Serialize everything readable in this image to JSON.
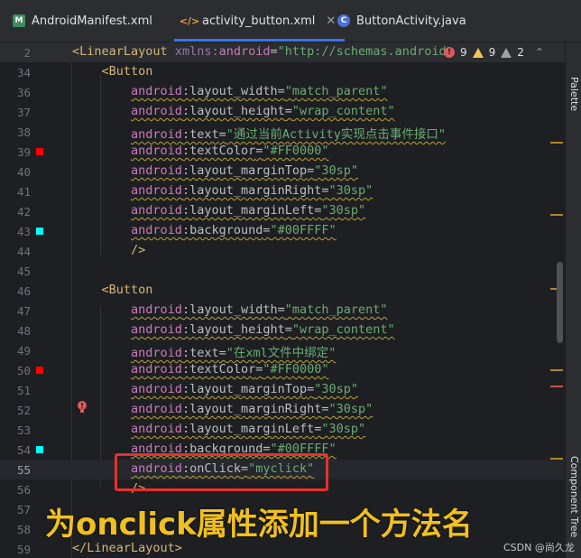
{
  "tabs": [
    {
      "icon": "manifest-icon",
      "label": "AndroidManifest.xml",
      "active": false
    },
    {
      "icon": "xml-code-icon",
      "label": "activity_button.xml",
      "active": true
    },
    {
      "icon": "java-class-icon",
      "label": "ButtonActivity.java",
      "active": false
    }
  ],
  "sticky": {
    "line": "2",
    "tag": "<LinearLayout",
    "attr_ns": "xmlns:",
    "attr": "android",
    "eq": "=",
    "value": "\"http://schemas.android"
  },
  "inspections": {
    "errors": "9",
    "warnings": "9",
    "weak": "2"
  },
  "right_panel": {
    "palette": "Palette",
    "component_tree": "Component Tree"
  },
  "lines": [
    {
      "n": "34",
      "indent": "    ",
      "tag": "<Button"
    },
    {
      "n": "36",
      "indent": "        ",
      "ns": "android",
      "attr": ":layout_width",
      "val": "\"match_parent\""
    },
    {
      "n": "37",
      "indent": "        ",
      "ns": "android",
      "attr": ":layout_height",
      "val": "\"wrap_content\""
    },
    {
      "n": "38",
      "indent": "        ",
      "ns": "android",
      "attr": ":text",
      "val": "\"通过当前Activity实现点击事件接口\""
    },
    {
      "n": "39",
      "indent": "        ",
      "ns": "android",
      "attr": ":textColor",
      "val": "\"#FF0000\""
    },
    {
      "n": "40",
      "indent": "        ",
      "ns": "android",
      "attr": ":layout_marginTop",
      "val": "\"30sp\""
    },
    {
      "n": "41",
      "indent": "        ",
      "ns": "android",
      "attr": ":layout_marginRight",
      "val": "\"30sp\""
    },
    {
      "n": "42",
      "indent": "        ",
      "ns": "android",
      "attr": ":layout_marginLeft",
      "val": "\"30sp\""
    },
    {
      "n": "43",
      "indent": "        ",
      "ns": "android",
      "attr": ":background",
      "val": "\"#00FFFF\""
    },
    {
      "n": "44",
      "indent": "        ",
      "tag": "/>"
    },
    {
      "n": "45",
      "indent": "",
      "tag": ""
    },
    {
      "n": "46",
      "indent": "    ",
      "tag": "<Button"
    },
    {
      "n": "47",
      "indent": "        ",
      "ns": "android",
      "attr": ":layout_width",
      "val": "\"match_parent\""
    },
    {
      "n": "48",
      "indent": "        ",
      "ns": "android",
      "attr": ":layout_height",
      "val": "\"wrap_content\""
    },
    {
      "n": "49",
      "indent": "        ",
      "ns": "android",
      "attr": ":text",
      "val": "\"在xml文件中绑定\""
    },
    {
      "n": "50",
      "indent": "        ",
      "ns": "android",
      "attr": ":textColor",
      "val": "\"#FF0000\""
    },
    {
      "n": "51",
      "indent": "        ",
      "ns": "android",
      "attr": ":layout_marginTop",
      "val": "\"30sp\""
    },
    {
      "n": "52",
      "indent": "        ",
      "ns": "android",
      "attr": ":layout_marginRight",
      "val": "\"30sp\""
    },
    {
      "n": "53",
      "indent": "        ",
      "ns": "android",
      "attr": ":layout_marginLeft",
      "val": "\"30sp\""
    },
    {
      "n": "54",
      "indent": "        ",
      "ns": "android",
      "attr": ":background",
      "val": "\"#00FFFF\""
    },
    {
      "n": "55",
      "indent": "        ",
      "ns": "android",
      "attr": ":onClick",
      "val": "\"myclick\""
    },
    {
      "n": "56",
      "indent": "        ",
      "tag": "/>"
    },
    {
      "n": "57",
      "indent": "",
      "tag": ""
    },
    {
      "n": "58",
      "indent": "",
      "tag": ""
    },
    {
      "n": "59",
      "indent": "",
      "tag": "</LinearLayout>"
    }
  ],
  "gutter_colors": {
    "39": "#FF0000",
    "43": "#00FFFF",
    "50": "#FF0000",
    "54": "#00FFFF"
  },
  "annotation": {
    "caption": "为onclick属性添加一个方法名",
    "watermark": "CSDN @尚久龙"
  },
  "colors": {
    "accent": "#3574f0",
    "highlight": "#e8302a",
    "caption": "#f0c020"
  }
}
